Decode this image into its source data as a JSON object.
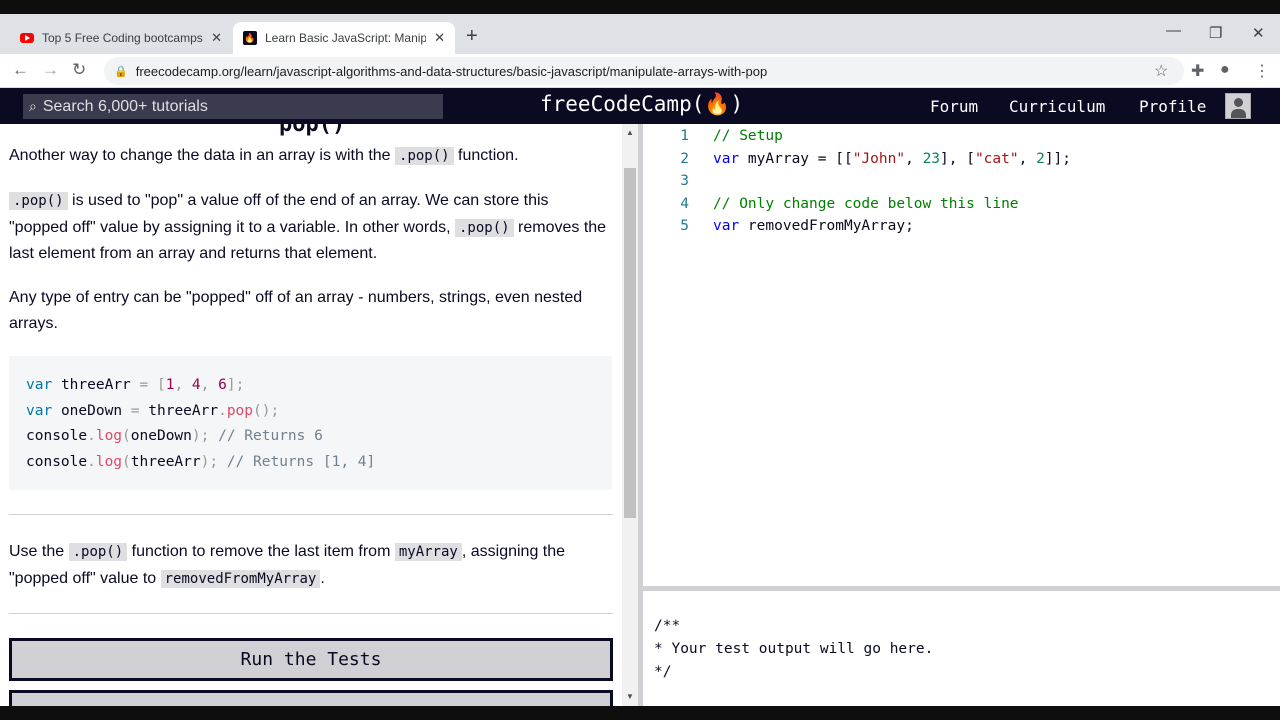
{
  "browser": {
    "tabs": [
      {
        "title": "Top 5 Free Coding bootcamps an",
        "icon": "youtube-icon",
        "active": false
      },
      {
        "title": "Learn Basic JavaScript: Manipulat",
        "icon": "freecodecamp-icon",
        "active": true
      }
    ],
    "url": "freecodecamp.org/learn/javascript-algorithms-and-data-structures/basic-javascript/manipulate-arrays-with-pop"
  },
  "nav": {
    "search_placeholder": "Search 6,000+ tutorials",
    "brand": "freeCodeCamp(🔥)",
    "links": [
      "Forum",
      "Curriculum",
      "Profile"
    ]
  },
  "lesson": {
    "heading_fragment": "pop()",
    "p1": {
      "before": "Another way to change the data in an array is with the ",
      "code": ".pop()",
      "after": " function."
    },
    "p2": {
      "code1": ".pop()",
      "text1": " is used to \"pop\" a value off of the end of an array. We can store this \"popped off\" value by assigning it to a variable. In other words, ",
      "code2": ".pop()",
      "text2": " removes the last element from an array and returns that element."
    },
    "p3": "Any type of entry can be \"popped\" off of an array - numbers, strings, even nested arrays.",
    "example_lines": [
      "var threeArr = [1, 4, 6];",
      "var oneDown = threeArr.pop();",
      "console.log(oneDown); // Returns 6",
      "console.log(threeArr); // Returns [1, 4]"
    ],
    "p4": {
      "t1": "Use the ",
      "c1": ".pop()",
      "t2": " function to remove the last item from ",
      "c2": "myArray",
      "t3": ", assigning the \"popped off\" value to ",
      "c3": "removedFromMyArray",
      "t4": "."
    },
    "run_button": "Run the Tests"
  },
  "editor": {
    "lines": [
      {
        "num": "1",
        "text": "// Setup"
      },
      {
        "num": "2",
        "text": "var myArray = [[\"John\", 23], [\"cat\", 2]];"
      },
      {
        "num": "3",
        "text": ""
      },
      {
        "num": "4",
        "text": "// Only change code below this line"
      },
      {
        "num": "5",
        "text": "var removedFromMyArray;"
      }
    ]
  },
  "output": {
    "lines": [
      "/**",
      "* Your test output will go here.",
      "*/"
    ]
  }
}
